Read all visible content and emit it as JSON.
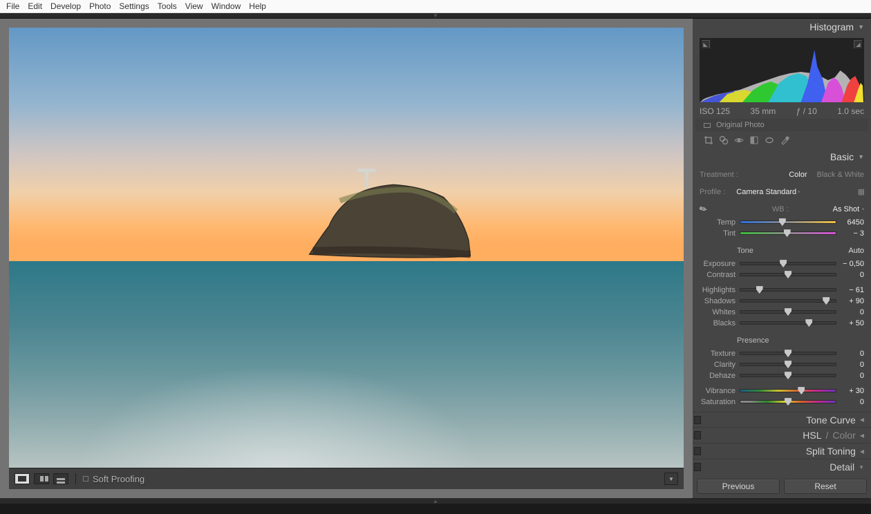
{
  "menu": [
    "File",
    "Edit",
    "Develop",
    "Photo",
    "Settings",
    "Tools",
    "View",
    "Window",
    "Help"
  ],
  "histogram": {
    "title": "Histogram",
    "iso": "ISO 125",
    "focal": "35 mm",
    "aperture": "ƒ / 10",
    "shutter": "1.0 sec",
    "original": "Original Photo"
  },
  "basic": {
    "title": "Basic",
    "treatment_label": "Treatment :",
    "treatment_color": "Color",
    "treatment_bw": "Black & White",
    "profile_label": "Profile :",
    "profile_value": "Camera Standard",
    "wb_label": "WB :",
    "wb_value": "As Shot",
    "tone_label": "Tone",
    "auto_label": "Auto",
    "presence_label": "Presence",
    "sliders": {
      "temp": {
        "label": "Temp",
        "value": "6450",
        "pos": 44
      },
      "tint": {
        "label": "Tint",
        "value": "− 3",
        "pos": 49
      },
      "exposure": {
        "label": "Exposure",
        "value": "− 0,50",
        "pos": 45
      },
      "contrast": {
        "label": "Contrast",
        "value": "0",
        "pos": 50
      },
      "highlights": {
        "label": "Highlights",
        "value": "− 61",
        "pos": 20
      },
      "shadows": {
        "label": "Shadows",
        "value": "+ 90",
        "pos": 90
      },
      "whites": {
        "label": "Whites",
        "value": "0",
        "pos": 50
      },
      "blacks": {
        "label": "Blacks",
        "value": "+ 50",
        "pos": 72
      },
      "texture": {
        "label": "Texture",
        "value": "0",
        "pos": 50
      },
      "clarity": {
        "label": "Clarity",
        "value": "0",
        "pos": 50
      },
      "dehaze": {
        "label": "Dehaze",
        "value": "0",
        "pos": 50
      },
      "vibrance": {
        "label": "Vibrance",
        "value": "+ 30",
        "pos": 64
      },
      "saturation": {
        "label": "Saturation",
        "value": "0",
        "pos": 50
      }
    }
  },
  "panels": {
    "tone_curve": "Tone Curve",
    "hsl": "HSL",
    "color": "Color",
    "split": "Split Toning",
    "detail": "Detail"
  },
  "buttons": {
    "prev": "Previous",
    "reset": "Reset"
  },
  "toolbar": {
    "soft_proof": "Soft Proofing"
  }
}
